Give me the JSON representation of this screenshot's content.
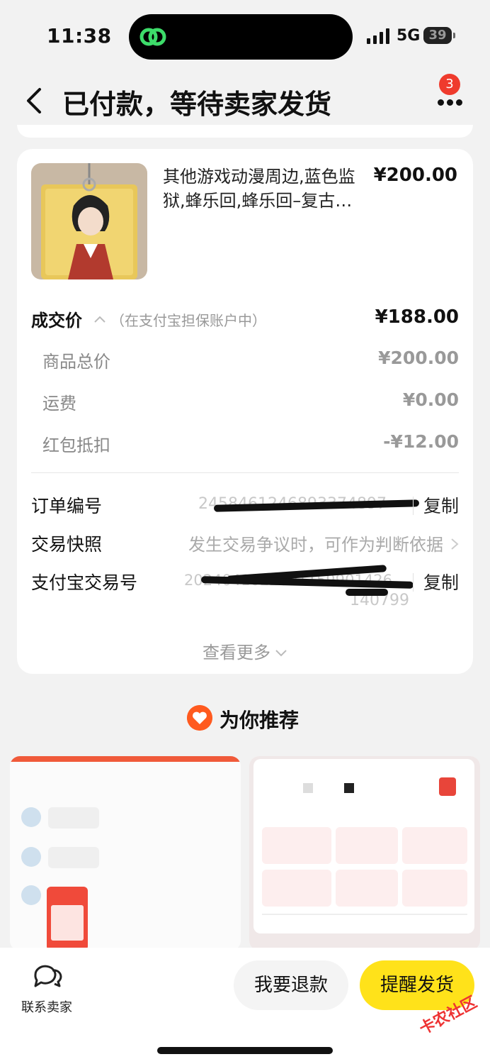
{
  "status": {
    "time": "11:38",
    "network": "5G",
    "battery": "39"
  },
  "nav": {
    "title": "已付款，等待卖家发货",
    "badge": "3"
  },
  "product": {
    "title": "其他游戏动漫周边,蓝色监狱,蜂乐回,蜂乐回–复古…",
    "price": "¥200.00",
    "image": "acrylic-keychain-photo"
  },
  "price_breakdown": {
    "deal_label": "成交价",
    "deal_note": "（在支付宝担保账户中）",
    "deal_value": "¥188.00",
    "items": [
      {
        "label": "商品总价",
        "value": "¥200.00"
      },
      {
        "label": "运费",
        "value": "¥0.00"
      },
      {
        "label": "红包抵扣",
        "value": "-¥12.00"
      }
    ]
  },
  "order_info": {
    "order_no_label": "订单编号",
    "order_no_value": "2458461246893374897",
    "copy_label": "复制",
    "snapshot_label": "交易快照",
    "snapshot_hint": "发生交易争议时，可作为判断依据",
    "alipay_label": "支付宝交易号",
    "alipay_value": "2024041022001159901426",
    "alipay_value2": "140799",
    "see_more": "查看更多"
  },
  "recommend": {
    "title": "为你推荐"
  },
  "bottom": {
    "contact": "联系卖家",
    "refund": "我要退款",
    "remind": "提醒发货"
  },
  "watermark": "卡农社区",
  "colors": {
    "accent": "#ffe21a",
    "badge": "#ef3b2d",
    "rec_icon": "#ff5a1f"
  }
}
